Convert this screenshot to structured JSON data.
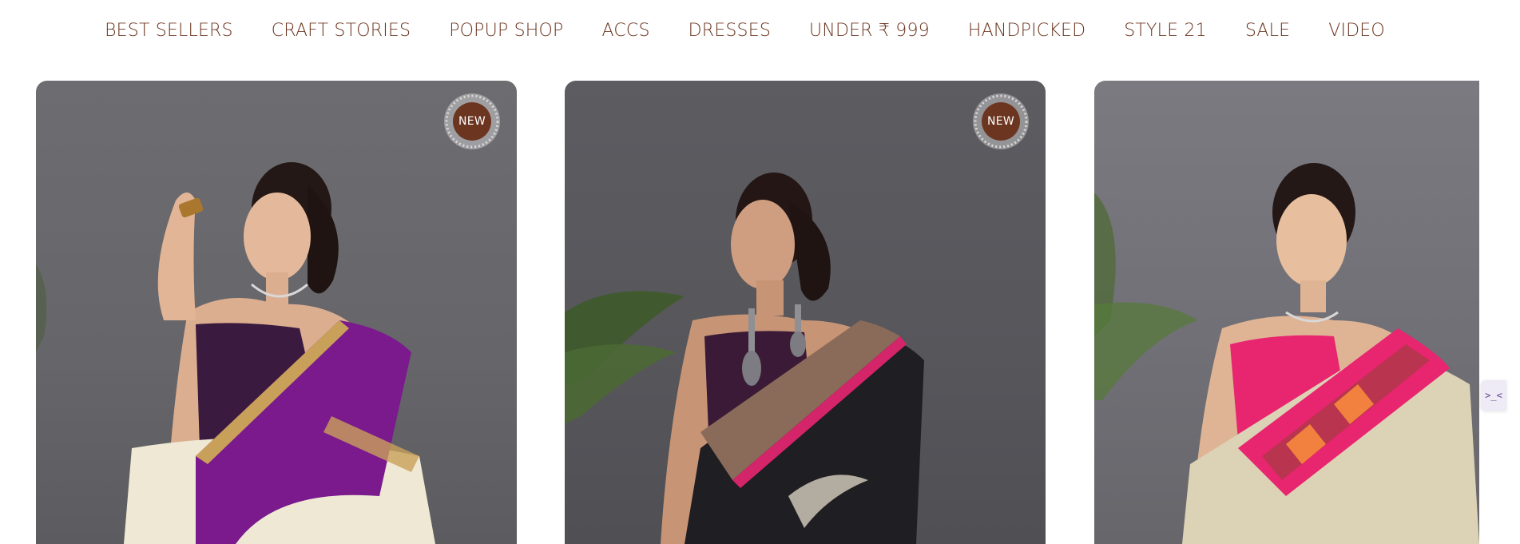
{
  "nav": {
    "items": [
      "BEST SELLERS",
      "CRAFT STORIES",
      "POPUP SHOP",
      "ACCS",
      "DRESSES",
      "UNDER ₹ 999",
      "HANDPICKED",
      "STYLE 21",
      "SALE",
      "VIDEO"
    ]
  },
  "products": [
    {
      "badge": "NEW",
      "image": "woman-in-purple-and-cream-saree",
      "saree_color": "#7a1a8c",
      "border_color": "#c9a05a",
      "body_color": "#eee8d4"
    },
    {
      "badge": "NEW",
      "image": "woman-in-black-and-gold-saree-with-pink-border",
      "saree_color": "#1f1e22",
      "border_color": "#8a6a58",
      "body_color": "#2a2a2e"
    },
    {
      "badge": "",
      "image": "woman-in-gold-saree-with-pink-patola-border",
      "saree_color": "#d9cfb3",
      "border_color": "#e8256f",
      "body_color": "#dcd2b5"
    }
  ],
  "theme": {
    "nav_color": "#6b3520",
    "badge_color": "#6b3520"
  },
  "side_widget": {
    "icon": "chat-widget-icon",
    "glyph": ">_<"
  }
}
